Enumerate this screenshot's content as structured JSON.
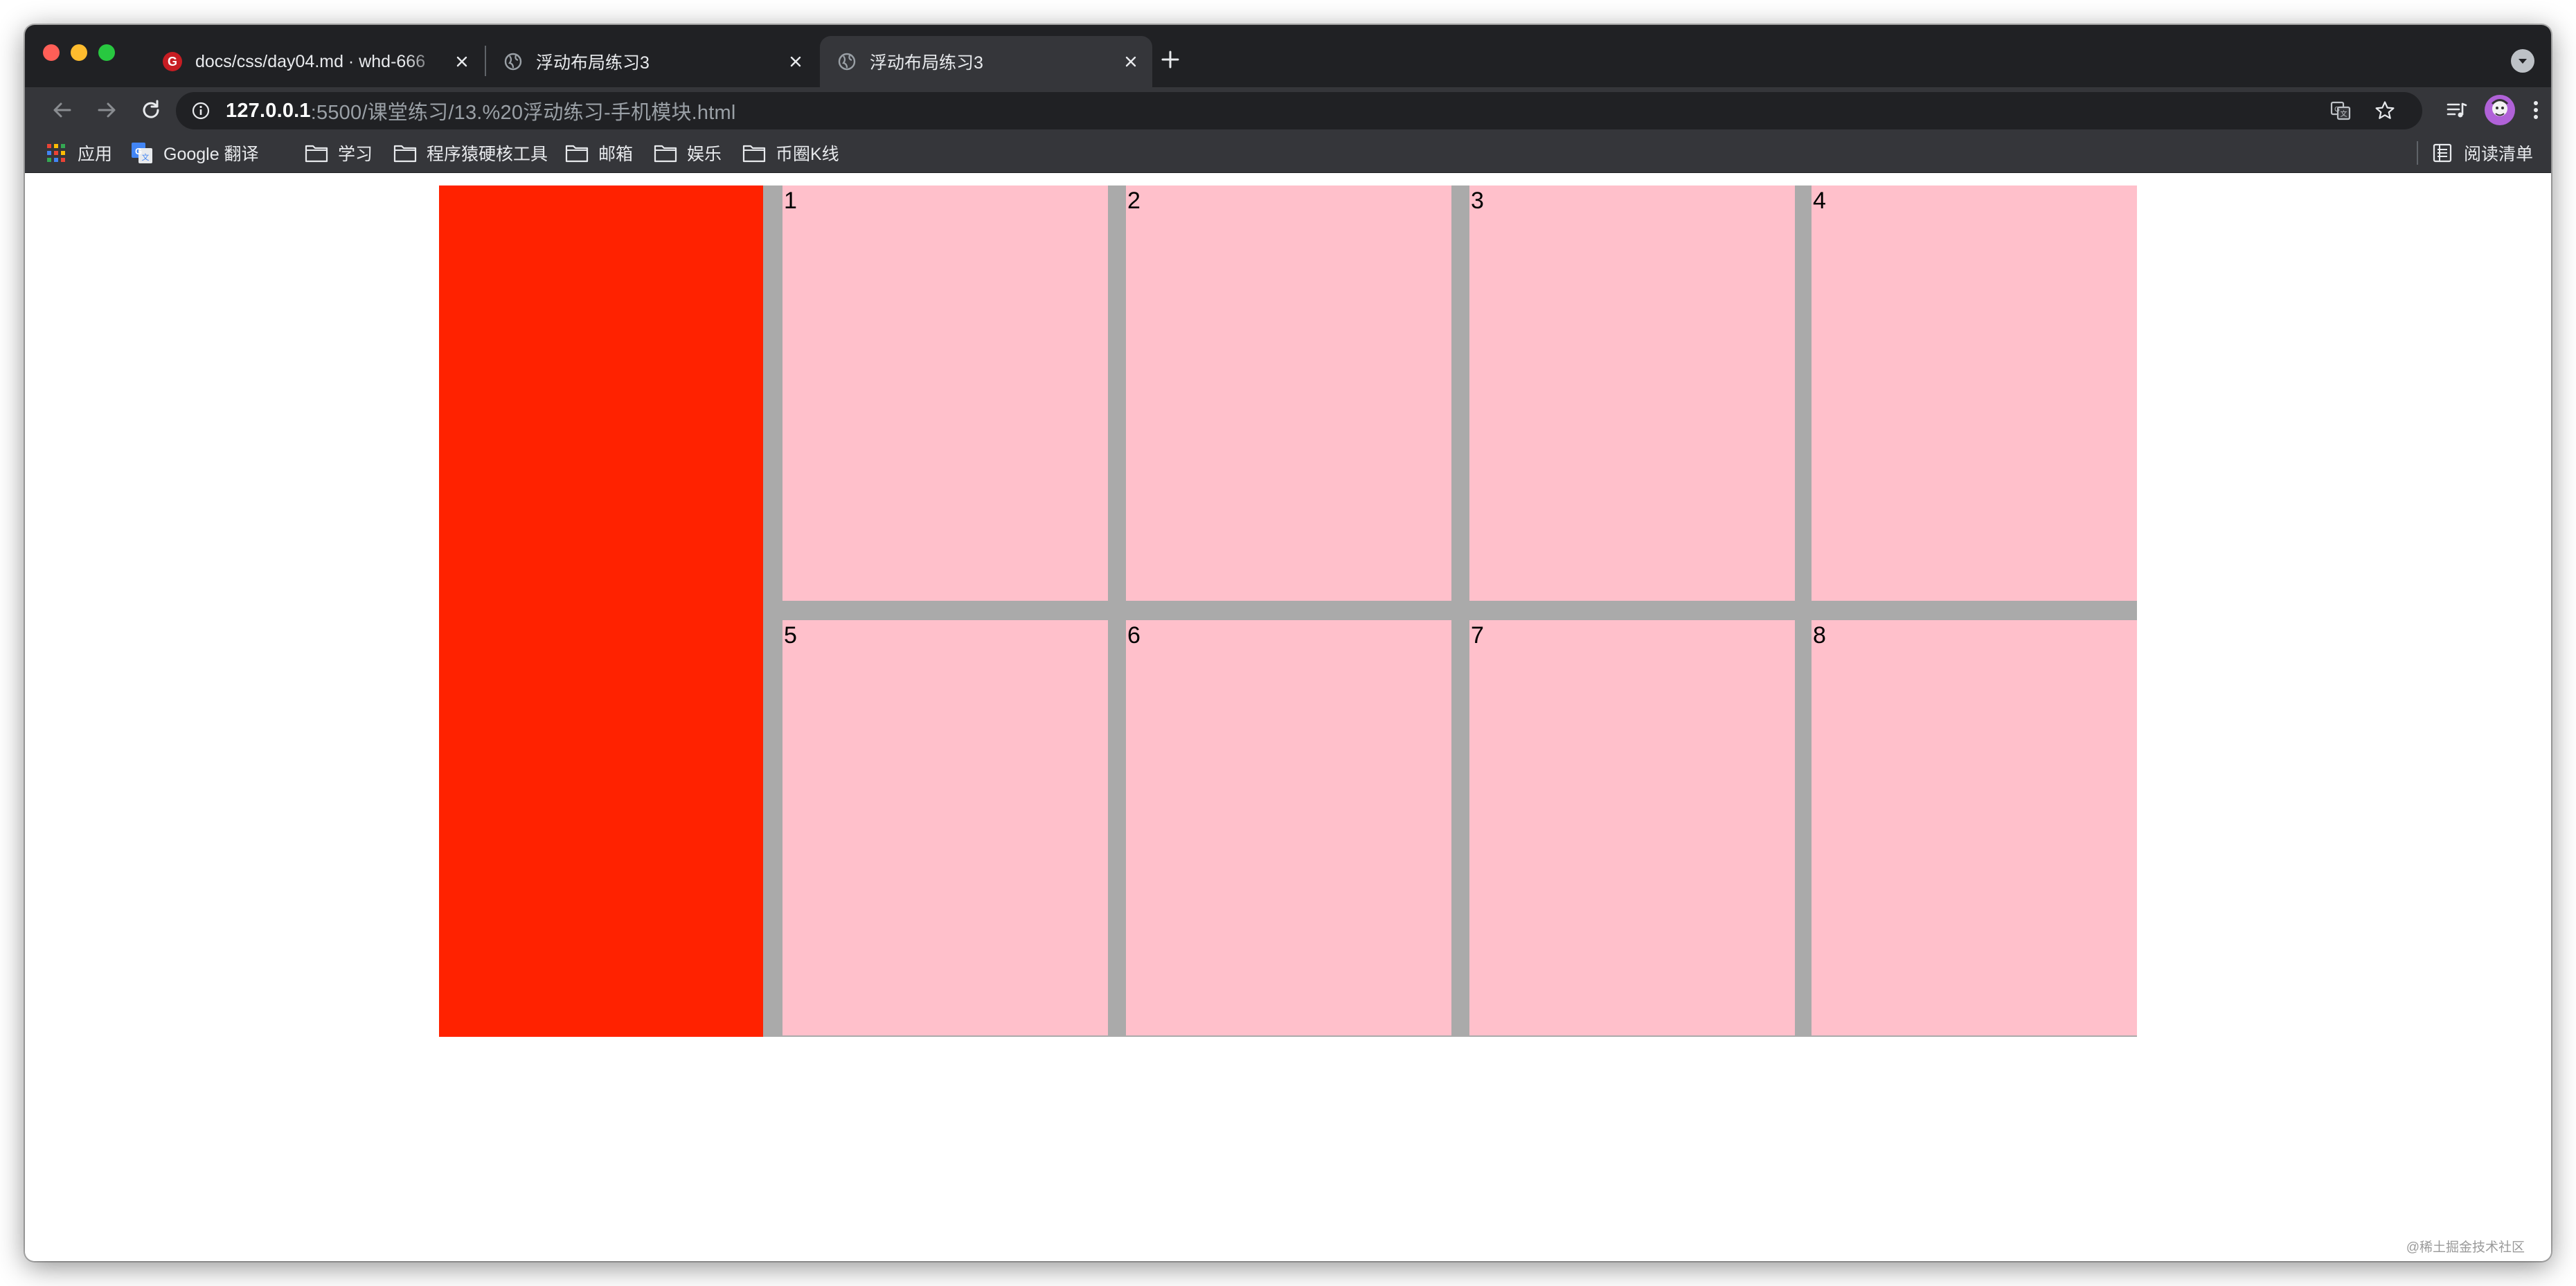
{
  "tabs": [
    {
      "title": "docs/css/day04.md · whd-666",
      "active": false,
      "favicon": "gitee-logo-icon"
    },
    {
      "title": "浮动布局练习3",
      "active": false,
      "favicon": "globe-icon"
    },
    {
      "title": "浮动布局练习3",
      "active": true,
      "favicon": "globe-icon"
    }
  ],
  "address_bar": {
    "host": "127.0.0.1",
    "path": ":5500/课堂练习/13.%20浮动练习-手机模块.html"
  },
  "bookmarks": [
    {
      "label": "应用",
      "icon": "apps-grid-icon"
    },
    {
      "label": "Google 翻译",
      "icon": "google-translate-icon"
    },
    {
      "label": "学习",
      "icon": "folder-icon"
    },
    {
      "label": "程序猿硬核工具",
      "icon": "folder-icon"
    },
    {
      "label": "邮箱",
      "icon": "folder-icon"
    },
    {
      "label": "娱乐",
      "icon": "folder-icon"
    },
    {
      "label": "币圈K线",
      "icon": "folder-icon"
    }
  ],
  "reading_list": {
    "label": "阅读清单",
    "icon": "reading-list-icon"
  },
  "page": {
    "cells": [
      "1",
      "2",
      "3",
      "4",
      "5",
      "6",
      "7",
      "8"
    ]
  },
  "colors": {
    "red_box": "#ff2200",
    "cell": "#ffc0cb",
    "grid_gap": "#aaaaaa",
    "tabstrip": "#202124",
    "toolbar": "#35363a"
  },
  "watermark": "@稀土掘金技术社区"
}
